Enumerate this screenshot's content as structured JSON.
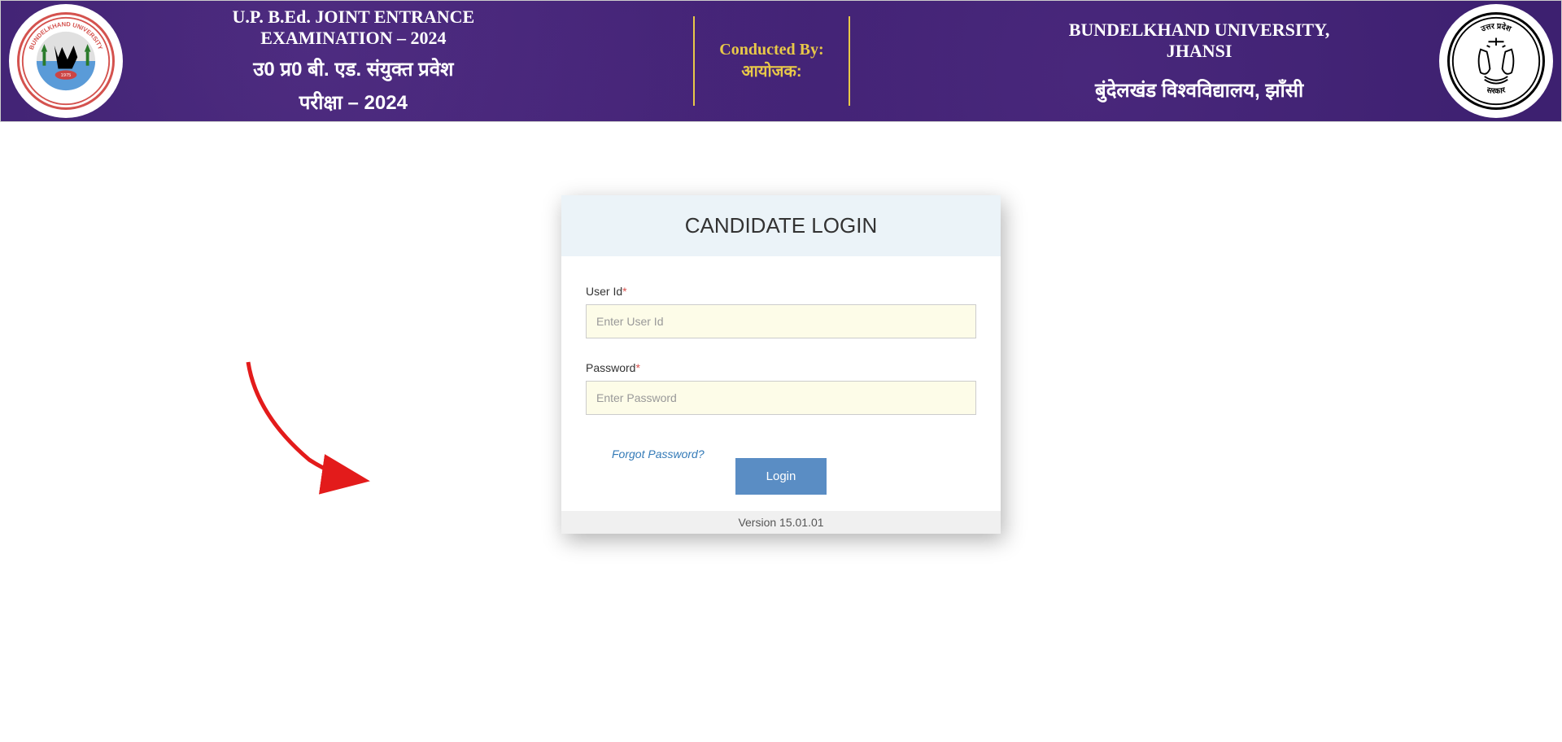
{
  "header": {
    "left": {
      "title_en_line1": "U.P. B.Ed. JOINT ENTRANCE",
      "title_en_line2": "EXAMINATION – 2024",
      "title_hi_line1": "उ0 प्र0 बी. एड. संयुक्त प्रवेश",
      "title_hi_line2": "परीक्षा – 2024"
    },
    "center": {
      "conducted_by": "Conducted By:",
      "conducted_by_hi": "आयोजक:"
    },
    "right": {
      "title_en_line1": "BUNDELKHAND UNIVERSITY,",
      "title_en_line2": "JHANSI",
      "title_hi": "बुंदेलखंड विश्वविद्यालय, झाँसी"
    }
  },
  "login": {
    "title": "CANDIDATE LOGIN",
    "userid_label": "User Id",
    "userid_placeholder": "Enter User Id",
    "password_label": "Password",
    "password_placeholder": "Enter Password",
    "forgot_password": "Forgot Password?",
    "login_button": "Login",
    "version": "Version 15.01.01",
    "required_mark": "*"
  }
}
